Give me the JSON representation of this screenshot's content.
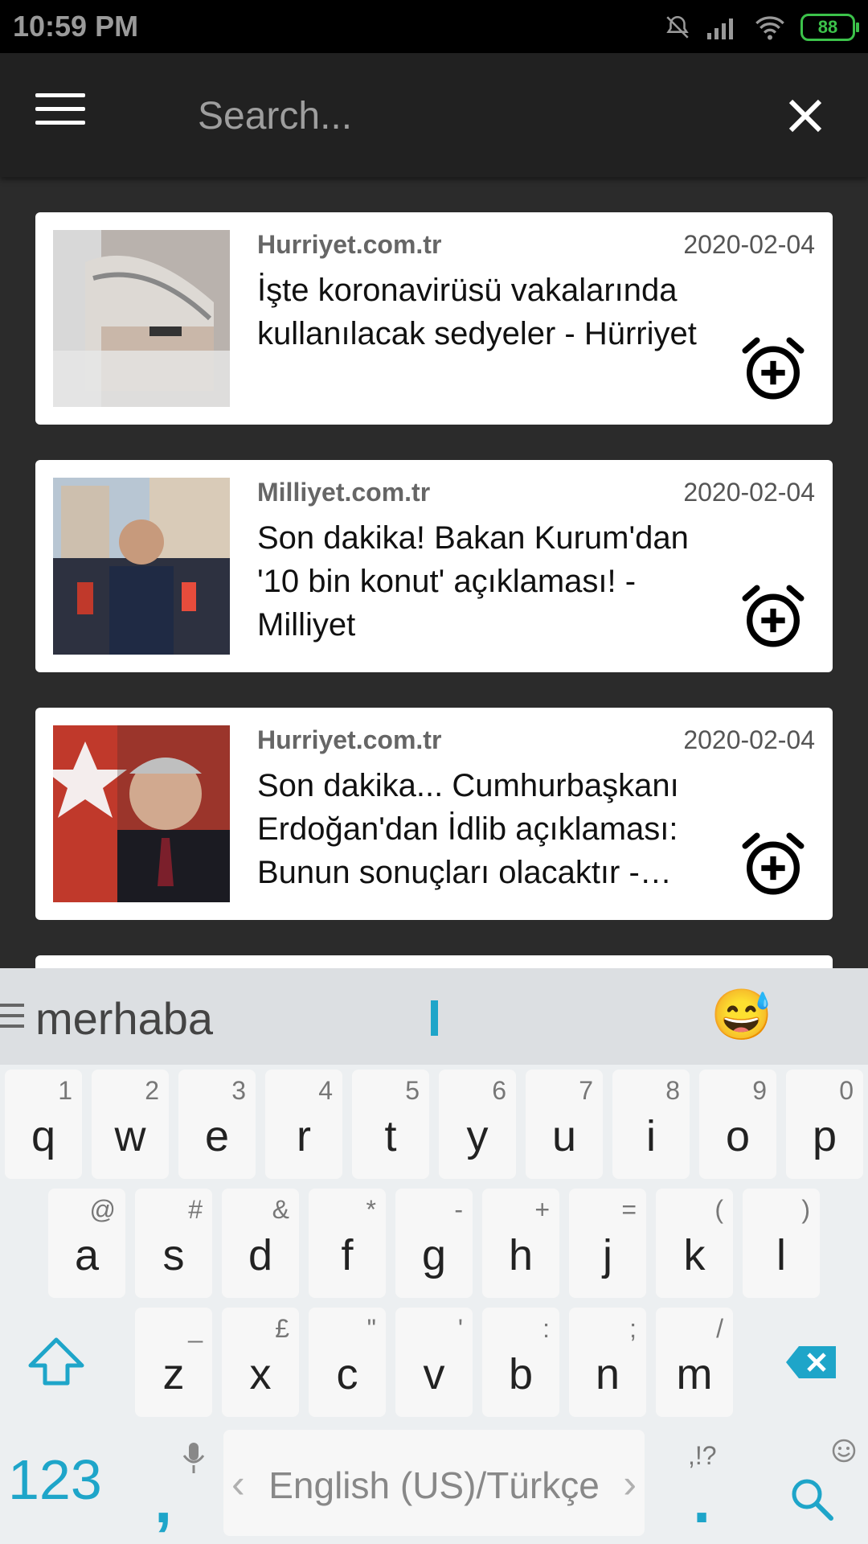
{
  "status": {
    "time": "10:59 PM",
    "battery": "88"
  },
  "search": {
    "placeholder": "Search..."
  },
  "articles": [
    {
      "source": "Hurriyet.com.tr",
      "date": "2020-02-04",
      "title": "İşte koronavirüsü vakalarında kullanılacak sedyeler - Hürriyet"
    },
    {
      "source": "Milliyet.com.tr",
      "date": "2020-02-04",
      "title": "Son dakika! Bakan Kurum'dan '10 bin konut' açıklaması! - Milliyet"
    },
    {
      "source": "Hurriyet.com.tr",
      "date": "2020-02-04",
      "title": "Son dakika... Cumhurbaşkanı Erdoğan'dan İdlib açıklaması: Bunun sonuçları olacaktır - Hürriyet"
    }
  ],
  "keyboard": {
    "suggestion": "merhaba",
    "row1": [
      {
        "k": "q",
        "s": "1"
      },
      {
        "k": "w",
        "s": "2"
      },
      {
        "k": "e",
        "s": "3"
      },
      {
        "k": "r",
        "s": "4"
      },
      {
        "k": "t",
        "s": "5"
      },
      {
        "k": "y",
        "s": "6"
      },
      {
        "k": "u",
        "s": "7"
      },
      {
        "k": "i",
        "s": "8"
      },
      {
        "k": "o",
        "s": "9"
      },
      {
        "k": "p",
        "s": "0"
      }
    ],
    "row2": [
      {
        "k": "a",
        "s": "@"
      },
      {
        "k": "s",
        "s": "#"
      },
      {
        "k": "d",
        "s": "&"
      },
      {
        "k": "f",
        "s": "*"
      },
      {
        "k": "g",
        "s": "-"
      },
      {
        "k": "h",
        "s": "+"
      },
      {
        "k": "j",
        "s": "="
      },
      {
        "k": "k",
        "s": "("
      },
      {
        "k": "l",
        "s": ")"
      }
    ],
    "row3": [
      {
        "k": "z",
        "s": "_"
      },
      {
        "k": "x",
        "s": "£"
      },
      {
        "k": "c",
        "s": "\""
      },
      {
        "k": "v",
        "s": "'"
      },
      {
        "k": "b",
        "s": ":"
      },
      {
        "k": "n",
        "s": ";"
      },
      {
        "k": "m",
        "s": "/"
      }
    ],
    "numbers_label": "123",
    "comma": ",",
    "space_label": "English (US)/Türkçe",
    "period": ".",
    "period_sub": ",!?"
  }
}
